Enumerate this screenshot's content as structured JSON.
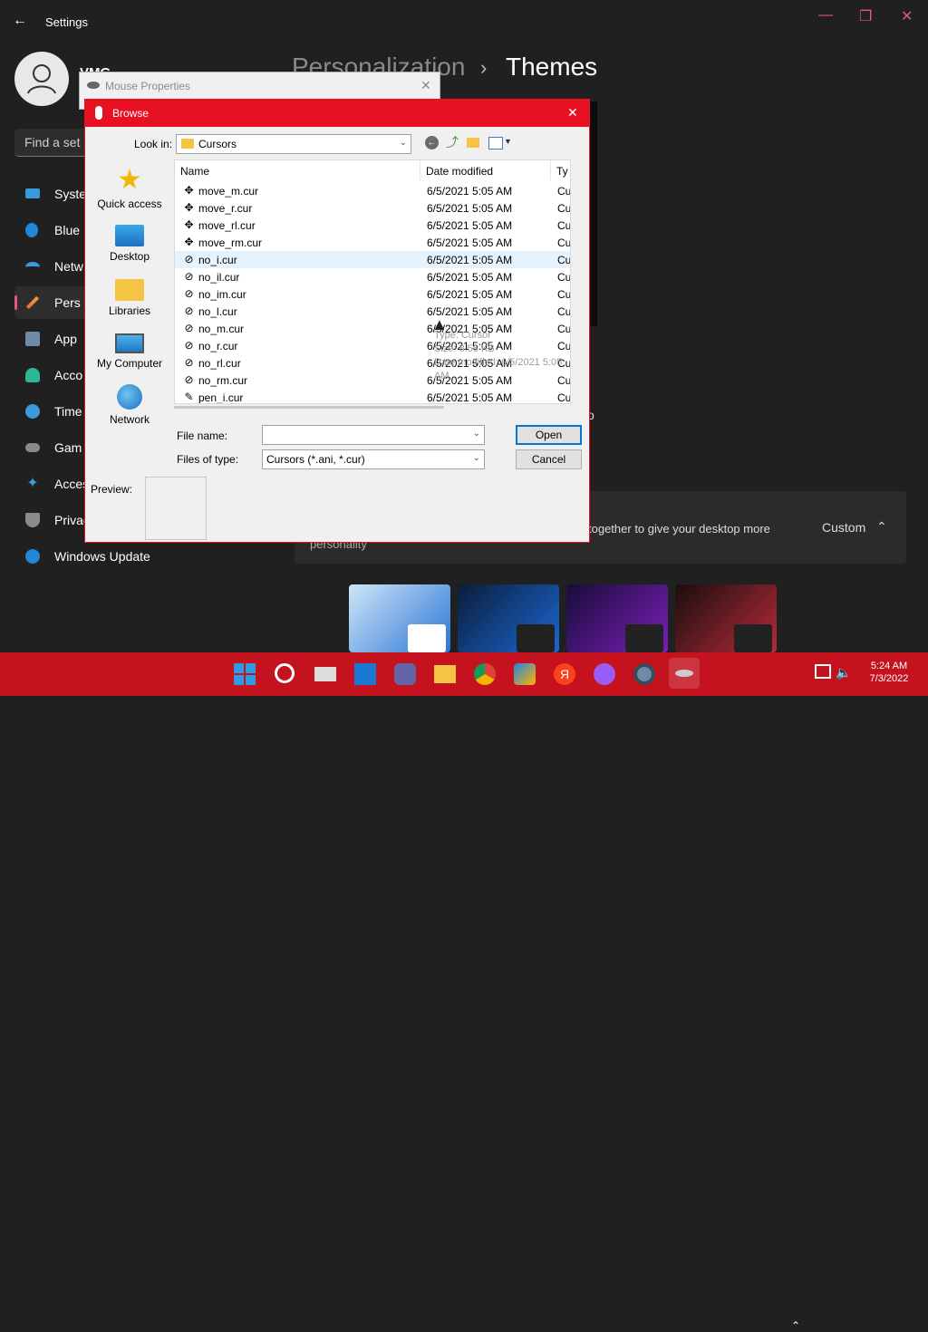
{
  "settings": {
    "title": "Settings",
    "user_name": "VMG",
    "search_placeholder": "Find a set",
    "breadcrumb_parent": "Personalization",
    "breadcrumb_sep": "›",
    "breadcrumb_current": "Themes",
    "nav": [
      {
        "label": "Syste",
        "icon": "monitor-icon"
      },
      {
        "label": "Blue",
        "icon": "bluetooth-icon"
      },
      {
        "label": "Netw",
        "icon": "wifi-icon"
      },
      {
        "label": "Pers",
        "icon": "brush-icon",
        "selected": true
      },
      {
        "label": "App",
        "icon": "apps-icon"
      },
      {
        "label": "Acco",
        "icon": "account-icon"
      },
      {
        "label": "Time",
        "icon": "clock-icon"
      },
      {
        "label": "Gam",
        "icon": "gamepad-icon"
      },
      {
        "label": "Acces",
        "icon": "accessibility-icon"
      },
      {
        "label": "Privac",
        "icon": "shield-icon"
      },
      {
        "label": "Windows Update",
        "icon": "update-icon"
      }
    ],
    "card_text": "together to give your desktop more",
    "card_text_2": "personality",
    "card_value": "Custom",
    "partial_text": "o"
  },
  "mouse_props": {
    "title": "Mouse Properties"
  },
  "browse": {
    "title": "Browse",
    "look_in_label": "Look in:",
    "look_in_value": "Cursors",
    "places": [
      "Quick access",
      "Desktop",
      "Libraries",
      "My Computer",
      "Network"
    ],
    "columns": [
      "Name",
      "Date modified",
      "Ty"
    ],
    "files": [
      {
        "name": "move_m.cur",
        "date": "6/5/2021 5:05 AM",
        "type": "Cu",
        "icon": "✥"
      },
      {
        "name": "move_r.cur",
        "date": "6/5/2021 5:05 AM",
        "type": "Cu",
        "icon": "✥"
      },
      {
        "name": "move_rl.cur",
        "date": "6/5/2021 5:05 AM",
        "type": "Cu",
        "icon": "✥"
      },
      {
        "name": "move_rm.cur",
        "date": "6/5/2021 5:05 AM",
        "type": "Cu",
        "icon": "✥"
      },
      {
        "name": "no_i.cur",
        "date": "6/5/2021 5:05 AM",
        "type": "Cu",
        "icon": "⊘"
      },
      {
        "name": "no_il.cur",
        "date": "6/5/2021 5:05 AM",
        "type": "Cu",
        "icon": "⊘"
      },
      {
        "name": "no_im.cur",
        "date": "6/5/2021 5:05 AM",
        "type": "Cu",
        "icon": "⊘"
      },
      {
        "name": "no_l.cur",
        "date": "6/5/2021 5:05 AM",
        "type": "Cu",
        "icon": "⊘"
      },
      {
        "name": "no_m.cur",
        "date": "6/5/2021 5:05 AM",
        "type": "Cu",
        "icon": "⊘"
      },
      {
        "name": "no_r.cur",
        "date": "6/5/2021 5:05 AM",
        "type": "Cu",
        "icon": "⊘"
      },
      {
        "name": "no_rl.cur",
        "date": "6/5/2021 5:05 AM",
        "type": "Cu",
        "icon": "⊘"
      },
      {
        "name": "no_rm.cur",
        "date": "6/5/2021 5:05 AM",
        "type": "Cu",
        "icon": "⊘"
      },
      {
        "name": "pen_i.cur",
        "date": "6/5/2021 5:05 AM",
        "type": "Cu",
        "icon": "✎"
      }
    ],
    "tooltip": [
      "Type: Cursor",
      "Size: 8.56 KB",
      "Date modified: 6/5/2021 5:05 AM"
    ],
    "file_name_label": "File name:",
    "file_name_value": "",
    "files_of_type_label": "Files of type:",
    "files_of_type_value": "Cursors (*.ani, *.cur)",
    "open_label": "Open",
    "cancel_label": "Cancel",
    "preview_label": "Preview:"
  },
  "taskbar": {
    "time": "5:24 AM",
    "date": "7/3/2022",
    "accent": "#c4121f"
  }
}
